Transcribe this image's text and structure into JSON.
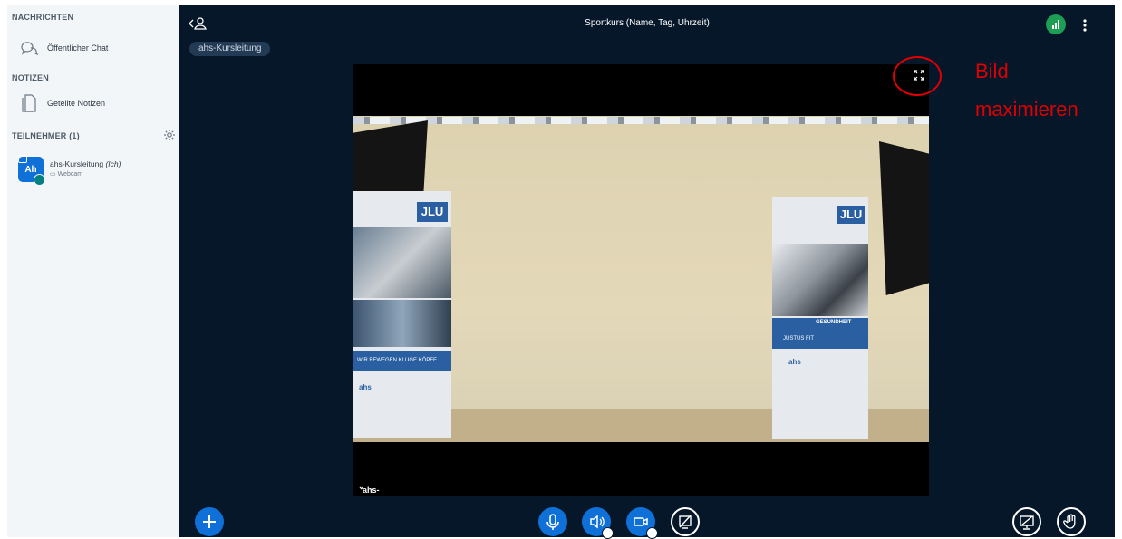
{
  "sidebar": {
    "messages_title": "NACHRICHTEN",
    "public_chat": "Öffentlicher Chat",
    "notes_title": "NOTIZEN",
    "shared_notes": "Geteilte Notizen",
    "participants_title": "TEILNEHMER (1)",
    "user": {
      "initials": "Ah",
      "name": "ahs-Kursleitung",
      "self_tag": "(Ich)",
      "subtitle": "Webcam"
    }
  },
  "header": {
    "title": "Sportkurs (Name, Tag, Uhrzeit)",
    "presenter_pill": "ahs-Kursleitung"
  },
  "video": {
    "label": "ahs-Kursleitung",
    "banner_left_text": "WIR BEWEGEN KLUGE KÖPFE",
    "banner_right_text": "JUSTUS FIT",
    "banner_right_heading": "GESUNDHEIT",
    "banner_logo": "JLU",
    "sports_logo": "ahs"
  },
  "annotation": {
    "line1": "Bild",
    "line2": "maximieren",
    "color": "#e00000"
  },
  "icons": {
    "chat": "chat-bubbles-icon",
    "notes": "document-icon",
    "gear": "gear-icon",
    "add": "plus-icon",
    "mic": "microphone-icon",
    "audio": "speaker-icon",
    "camera": "video-camera-icon",
    "screen": "screen-share-off-icon",
    "presentation": "presentation-icon",
    "hand": "raise-hand-icon",
    "fullscreen": "expand-icon"
  },
  "colors": {
    "main_bg": "#06172a",
    "sidebar_bg": "#f3f6f9",
    "accent": "#0f70d7",
    "connection": "#1f9d55"
  }
}
